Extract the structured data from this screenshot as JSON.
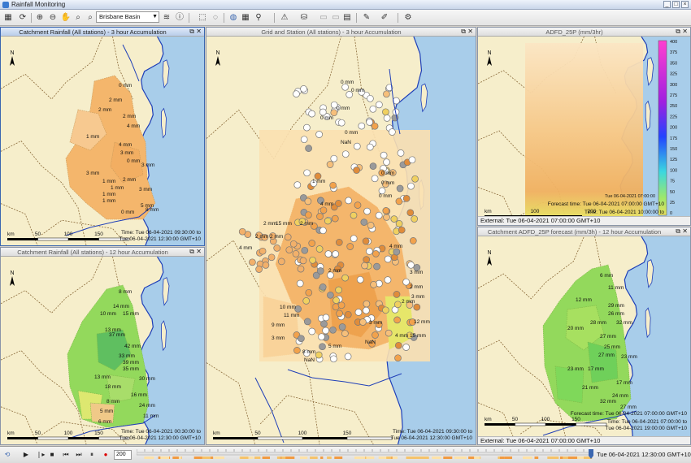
{
  "app": {
    "title": "Rainfall Monitoring"
  },
  "toolbar": {
    "basin_select": "Brisbane Basin",
    "icons": [
      "grid-icon",
      "refresh-icon",
      "zoom-in-icon",
      "zoom-out-icon",
      "pan-hand-icon",
      "zoom-extent-icon",
      "zoom-region-icon",
      "layers-icon",
      "info-icon",
      "select-rect-icon",
      "lasso-icon",
      "globe-icon",
      "table-icon",
      "location-pin-icon",
      "warning-icon",
      "paint-icon",
      "chart-icon",
      "pencil-icon",
      "edit-icon",
      "settings-icon"
    ]
  },
  "panels": {
    "p1": {
      "title": "Catchment Rainfall (All stations) - 3 hour Accumulation",
      "time": "Time: Tue 06-04-2021 09:30:00 to Tue 06-04-2021 12:30:00 GMT+10",
      "labels": [
        "0 mm",
        "2 mm",
        "2 mm",
        "2 mm",
        "4 mm",
        "1 mm",
        "3 mm",
        "4 mm",
        "3 mm",
        "0 mm",
        "3 mm",
        "1 mm",
        "2 mm",
        "1 mm",
        "1 mm",
        "3 mm",
        "1 mm",
        "0 mm",
        "5 mm",
        "8 mm"
      ]
    },
    "p2": {
      "title": "Grid and Station (All stations) - 3 hour Accumulation",
      "time": "Time: Tue 06-04-2021 09:30:00 to Tue 06-04-2021 12:30:00 GMT+10",
      "labels": [
        "0 mm",
        "0 mm",
        "0 mm",
        "0 mm",
        "NaN",
        "0 mm",
        "0 mm",
        "0 mm",
        "0 mm",
        "1 mm",
        "4 mm",
        "2 mm",
        "15 mm",
        "2 mm",
        "2 mm",
        "4 mm",
        "2 mm",
        "4 mm",
        "10 mm",
        "11 mm",
        "9 mm",
        "3 mm",
        "3 mm",
        "2 mm",
        "3 mm",
        "4 mm",
        "3 mm",
        "12 mm",
        "15 mm",
        "2 mm",
        "2 mm",
        "5 mm",
        "8 mm",
        "NaN",
        "NaN"
      ]
    },
    "p3": {
      "title": "ADFD_25P (mm/3hr)",
      "forecast": "Forecast time: Tue 06-04-2021 07:00:00 GMT+10",
      "time": "Time: Tue 06-04-2021 10:00:00 to Tue 06-04-2021 13:00:00 GMT+10",
      "status": "External: Tue 06-04-2021 07:00:00 GMT+10",
      "legend_ticks": [
        "400",
        "375",
        "350",
        "325",
        "300",
        "275",
        "250",
        "225",
        "200",
        "175",
        "150",
        "125",
        "100",
        "75",
        "50",
        "25",
        "0"
      ]
    },
    "p4": {
      "title": "Catchment Rainfall (All stations) - 12 hour Accumulation",
      "time": "Time: Tue 06-04-2021 00:30:00 to Tue 06-04-2021 12:30:00 GMT+10",
      "labels": [
        "8 mm",
        "14 mm",
        "10 mm",
        "15 mm",
        "13 mm",
        "37 mm",
        "42 mm",
        "33 mm",
        "39 mm",
        "35 mm",
        "30 mm",
        "13 mm",
        "18 mm",
        "8 mm",
        "16 mm",
        "24 mm",
        "5 mm",
        "6 mm",
        "11 mm"
      ]
    },
    "p5": {
      "title": "Catchment ADFD_25P forecast (mm/3h) - 12 hour Accumulation",
      "forecast": "Forecast time: Tue 06-04-2021 07:00:00 GMT+10",
      "time": "Time: Tue 06-04-2021 07:00:00 to Tue 06-04-2021 19:00:00 GMT+10",
      "status": "External: Tue 06-04-2021 07:00:00 GMT+10",
      "labels": [
        "6 mm",
        "11 mm",
        "12 mm",
        "29 mm",
        "26 mm",
        "28 mm",
        "32 mm",
        "20 mm",
        "27 mm",
        "25 mm",
        "27 mm",
        "23 mm",
        "23 mm",
        "17 mm",
        "17 mm",
        "21 mm",
        "24 mm",
        "32 mm",
        "27 mm"
      ]
    }
  },
  "scale": {
    "km": "km",
    "t50": "50",
    "t100": "100",
    "t150": "150",
    "t200": "200",
    "north": "N"
  },
  "playback": {
    "step": "200",
    "timestamp": "Tue 06-04-2021 12:30:00 GMT+10"
  },
  "colors": {
    "sea": "#a8cdea",
    "land": "#f6eecb",
    "accent": "#3a66b0",
    "orange": "#f4b66c",
    "green": "#93d95c"
  }
}
